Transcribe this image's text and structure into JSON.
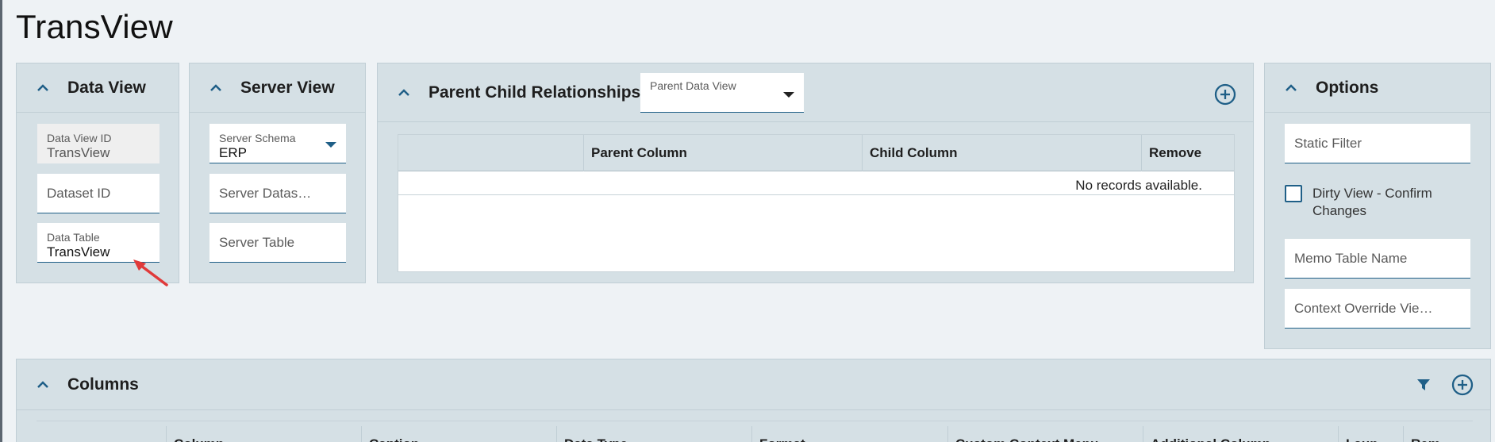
{
  "app": {
    "title": "TransView"
  },
  "data_view": {
    "title": "Data View",
    "data_view_id_label": "Data View ID",
    "data_view_id_value": "TransView",
    "dataset_id_placeholder": "Dataset ID",
    "data_table_label": "Data Table",
    "data_table_value": "TransView"
  },
  "server_view": {
    "title": "Server View",
    "schema_label": "Server Schema",
    "schema_value": "ERP",
    "dataset_placeholder": "Server Datas…",
    "table_placeholder": "Server Table"
  },
  "relationships": {
    "title": "Parent Child Relationships",
    "parent_dropdown_label": "Parent Data View",
    "columns": [
      "",
      "Parent Column",
      "Child Column",
      "Remove"
    ],
    "empty_text": "No records available."
  },
  "options": {
    "title": "Options",
    "static_filter_placeholder": "Static Filter",
    "dirty_view_label_line1": "Dirty View - Confirm",
    "dirty_view_label_line2": "Changes",
    "dirty_view_checked": false,
    "memo_table_placeholder": "Memo Table Name",
    "context_override_placeholder": "Context Override Vie…"
  },
  "columns_panel": {
    "title": "Columns",
    "headers": [
      "",
      "Column",
      "Caption",
      "Data Type",
      "Format",
      "Custom Context Menu",
      "Additional Column",
      "Laun…",
      "Rem…"
    ]
  },
  "colors": {
    "accent": "#1f5f87",
    "panel": "#d5e0e5",
    "annotation_arrow": "#e03a3a"
  },
  "icons": [
    "chevron-up-icon",
    "chevron-down-icon",
    "add-circle-icon",
    "filter-icon",
    "annotation-arrow-icon"
  ]
}
